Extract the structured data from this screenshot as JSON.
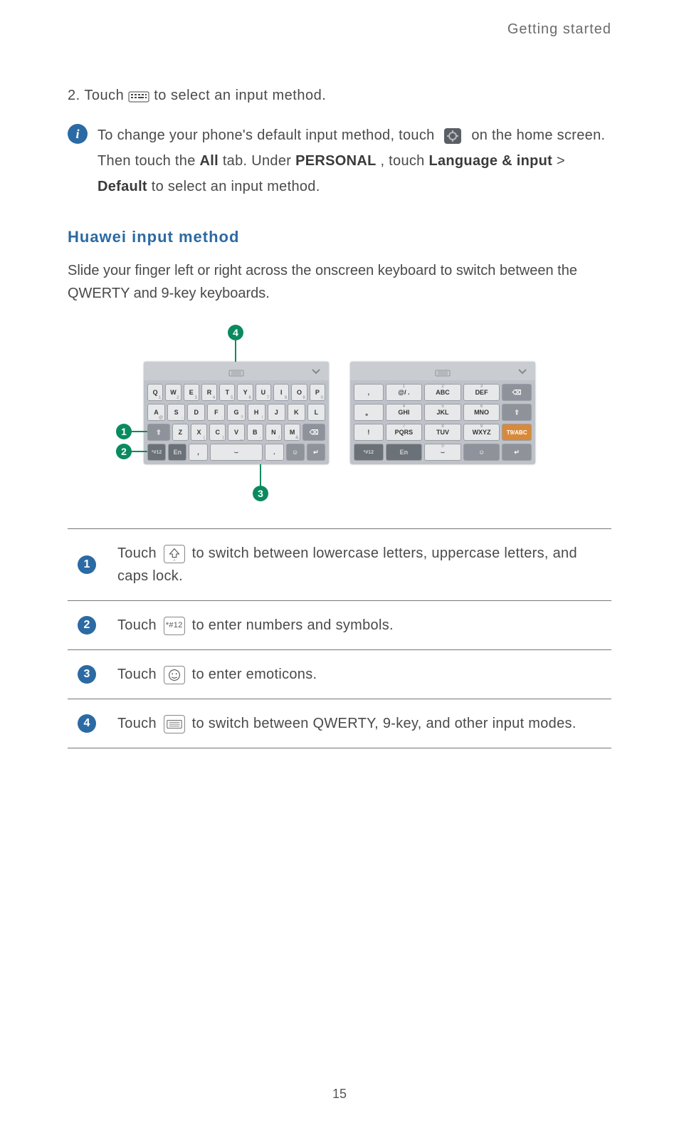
{
  "header": {
    "title": "Getting started"
  },
  "step2": {
    "prefix": "2. Touch ",
    "suffix": " to select an input method."
  },
  "info": {
    "symbol": "i",
    "text_p1": "To change your phone's default input method, touch ",
    "text_p2": " on the home screen. Then touch the ",
    "all_tab": "All",
    "text_p3": " tab. Under ",
    "personal": "PERSONAL",
    "text_p4": ", touch ",
    "lang_input": "Language & input",
    "text_p5": " > ",
    "default": "Default",
    "text_p6": " to select an input method."
  },
  "section": {
    "heading": "Huawei input method",
    "intro": "Slide your finger left or right across the onscreen keyboard to switch between the QWERTY and 9-key keyboards."
  },
  "kb": {
    "qwerty": {
      "row1": [
        "Q",
        "W",
        "E",
        "R",
        "T",
        "Y",
        "U",
        "I",
        "O",
        "P"
      ],
      "row1sub": [
        "1",
        "2",
        "3",
        "4",
        "5",
        "6",
        "7",
        "8",
        "9",
        "0"
      ],
      "row2": [
        "A",
        "S",
        "D",
        "F",
        "G",
        "H",
        "J",
        "K",
        "L"
      ],
      "row2sub": [
        "@",
        "-",
        "",
        ":",
        "?",
        "!",
        "",
        "",
        ""
      ],
      "row3_shift": "⇧",
      "row3": [
        "Z",
        "X",
        "C",
        "V",
        "B",
        "N",
        "M"
      ],
      "row3sub": [
        "",
        "(",
        ")",
        "_",
        "-",
        "/",
        "&"
      ],
      "row3_del": "⌫",
      "row4_sym": "*#12",
      "row4_en": "En",
      "row4_comma": ",",
      "row4_space": "⌣",
      "row4_dot": ".",
      "row4_emoji": "☺",
      "row4_enter": "↵"
    },
    "ninekey": {
      "row1": [
        ",",
        "@/ .",
        "ABC",
        "DEF"
      ],
      "row1sub": [
        "",
        "1",
        "2",
        "3"
      ],
      "row1_del": "⌫",
      "row2": [
        "。",
        "GHI",
        "JKL",
        "MNO"
      ],
      "row2sub": [
        "",
        "4",
        "5",
        "6"
      ],
      "row2_shift": "⇧",
      "row3": [
        "!",
        "PQRS",
        "TUV",
        "WXYZ"
      ],
      "row3sub": [
        "",
        "7",
        "8",
        "9"
      ],
      "row3_mode": "T9/ABC",
      "row4_sym": "*#12",
      "row4_en": "En",
      "row4_zero": "0",
      "row4_space": "⌣",
      "row4_emoji": "☺",
      "row4_enter": "↵"
    }
  },
  "legend": {
    "1": {
      "pre": "Touch ",
      "post": " to switch between lowercase letters, uppercase letters, and caps lock."
    },
    "2": {
      "pre": "Touch ",
      "icon_text": "*#12",
      "post": " to enter numbers and symbols."
    },
    "3": {
      "pre": "Touch ",
      "post": " to enter emoticons."
    },
    "4": {
      "pre": "Touch ",
      "post": " to switch between QWERTY, 9-key, and other input modes."
    }
  },
  "page_number": "15"
}
